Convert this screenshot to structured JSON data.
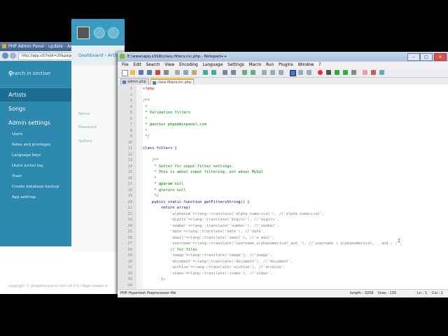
{
  "browser": {
    "title": "PHP Admin Panel - update - Artists",
    "url": "http://app.s3/?edit=20&page=1&section",
    "search_placeholder": "Search in section",
    "breadcrumb": "Dashboard › Artis",
    "nav": [
      {
        "label": "Artists",
        "active": true
      },
      {
        "label": "Songs",
        "active": false
      },
      {
        "label": "Admin settings",
        "active": false
      }
    ],
    "subnav": [
      "Users",
      "Roles and privileges",
      "Language keys",
      "Users action log",
      "Trash",
      "Create database backup",
      "App settings"
    ],
    "fields": [
      "Name",
      "Password",
      "Gallery"
    ],
    "footer": "copyright © phpadminpanel.com v4.0.0 / Page loaded in"
  },
  "npp": {
    "title": "E:\\www\\app.s3\\lib\\class.filters.inc.php - Notepad++",
    "menu": [
      "File",
      "Edit",
      "Search",
      "View",
      "Encoding",
      "Language",
      "Settings",
      "Macro",
      "Run",
      "Plugins",
      "Window",
      "?"
    ],
    "tabs": [
      {
        "label": "admin.php",
        "active": false
      },
      {
        "label": "class.filters.inc.php",
        "active": true
      }
    ],
    "lines": [
      {
        "n": "1",
        "cls": "c-tag",
        "text": "<?php"
      },
      {
        "n": "2",
        "cls": "c-def",
        "text": ""
      },
      {
        "n": "3",
        "cls": "c-cm",
        "text": "/**"
      },
      {
        "n": "4",
        "cls": "c-cm",
        "text": " *"
      },
      {
        "n": "5",
        "cls": "c-cm",
        "text": " * Validation filters"
      },
      {
        "n": "6",
        "cls": "c-cm",
        "text": " *"
      },
      {
        "n": "7",
        "cls": "c-cm",
        "text": " * @author phpadminpanel.com"
      },
      {
        "n": "8",
        "cls": "c-cm",
        "text": " *"
      },
      {
        "n": "9",
        "cls": "c-cm",
        "text": " */"
      },
      {
        "n": "10",
        "cls": "c-def",
        "text": ""
      },
      {
        "n": "11",
        "cls": "c-kw",
        "text": "class filters {"
      },
      {
        "n": "12",
        "cls": "c-def",
        "text": ""
      },
      {
        "n": "13",
        "cls": "c-cm",
        "text": "    /**"
      },
      {
        "n": "14",
        "cls": "c-cm",
        "text": "     * Setter for input filter settings."
      },
      {
        "n": "15",
        "cls": "c-cm",
        "text": "     * This is about input filtering, not about MySql"
      },
      {
        "n": "16",
        "cls": "c-cm",
        "text": "     *"
      },
      {
        "n": "17",
        "cls": "c-cm",
        "text": "     * @param null"
      },
      {
        "n": "18",
        "cls": "c-cm",
        "text": "     * @return null"
      },
      {
        "n": "19",
        "cls": "c-cm",
        "text": "     */"
      },
      {
        "n": "20",
        "cls": "c-kw",
        "text": "    public static function getFiltersString() {"
      },
      {
        "n": "21",
        "cls": "c-kw",
        "text": "        return array("
      },
      {
        "n": "22",
        "cls": "c-str",
        "text": "            'alphanum'=>lang::translate('alpha_numerical'), //'alpha numerical',"
      },
      {
        "n": "23",
        "cls": "c-str",
        "text": "            'digits'=>lang::translate('digits'), //'digits',"
      },
      {
        "n": "24",
        "cls": "c-str",
        "text": "            'number'=>lang::translate('number'), //'number',"
      },
      {
        "n": "25",
        "cls": "c-str",
        "text": "            'date'=>lang::translate('date'), //'date',"
      },
      {
        "n": "26",
        "cls": "c-str",
        "text": "            'email'=>lang::translate('email'), //'e-mail',"
      },
      {
        "n": "27",
        "cls": "c-str",
        "text": "            'username'=>lang::translate('username_alphanumerical_and_'), //'username ( alphanumerical, _ and - )',"
      },
      {
        "n": "28",
        "cls": "c-cm",
        "text": "            // for files"
      },
      {
        "n": "29",
        "cls": "c-str",
        "text": "            'image'=>lang::translate('image'), //'image',"
      },
      {
        "n": "30",
        "cls": "c-str",
        "text": "            'document'=>lang::translate('document'), //'document',"
      },
      {
        "n": "31",
        "cls": "c-str",
        "text": "            'archive'=>lang::translate('archive'), //'archive',"
      },
      {
        "n": "32",
        "cls": "c-str",
        "text": "            'video'=>lang::translate('video'), //'video',"
      },
      {
        "n": "33",
        "cls": "c-kw",
        "text": "        );"
      },
      {
        "n": "34",
        "cls": "c-def",
        "text": ""
      }
    ],
    "status": {
      "type": "PHP Hypertext Preprocessor file",
      "length": "length : 3258",
      "lines": "lines : 135",
      "pos": "Ln : 1",
      "col": "Col : 1"
    }
  }
}
